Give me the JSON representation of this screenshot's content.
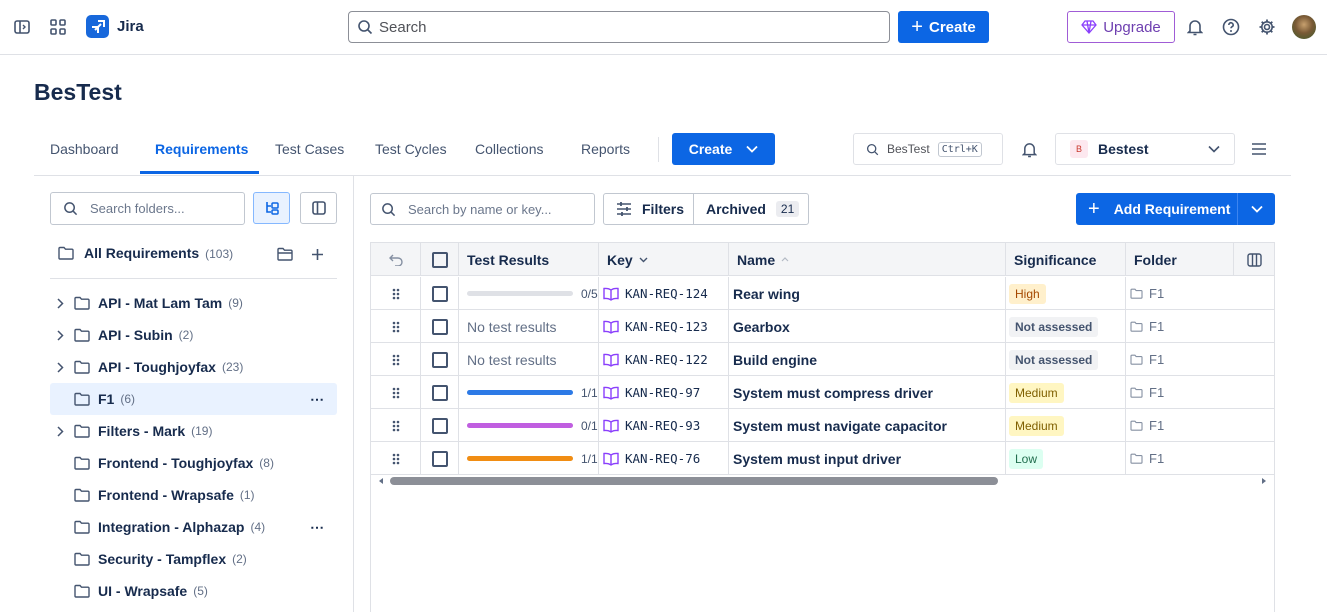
{
  "topbar": {
    "app_name": "Jira",
    "search_placeholder": "Search",
    "create_label": "Create",
    "upgrade_label": "Upgrade"
  },
  "project": {
    "title": "BesTest",
    "tabs": [
      {
        "label": "Dashboard",
        "active": false
      },
      {
        "label": "Requirements",
        "active": true
      },
      {
        "label": "Test Cases",
        "active": false
      },
      {
        "label": "Test Cycles",
        "active": false
      },
      {
        "label": "Collections",
        "active": false
      },
      {
        "label": "Reports",
        "active": false
      }
    ],
    "create_label": "Create",
    "search_label": "BesTest",
    "shortcut": "Ctrl+K",
    "selector_badge": "B",
    "selector_label": "Bestest"
  },
  "sidebar": {
    "search_placeholder": "Search folders...",
    "all_label": "All Requirements",
    "all_count": "(103)",
    "folders": [
      {
        "name": "API - Mat Lam Tam",
        "count": "(9)",
        "expandable": true,
        "selected": false,
        "more": false
      },
      {
        "name": "API - Subin",
        "count": "(2)",
        "expandable": true,
        "selected": false,
        "more": false
      },
      {
        "name": "API - Toughjoyfax",
        "count": "(23)",
        "expandable": true,
        "selected": false,
        "more": false
      },
      {
        "name": "F1",
        "count": "(6)",
        "expandable": false,
        "selected": true,
        "more": true
      },
      {
        "name": "Filters - Mark",
        "count": "(19)",
        "expandable": true,
        "selected": false,
        "more": false
      },
      {
        "name": "Frontend - Toughjoyfax",
        "count": "(8)",
        "expandable": false,
        "selected": false,
        "more": false
      },
      {
        "name": "Frontend - Wrapsafe",
        "count": "(1)",
        "expandable": false,
        "selected": false,
        "more": false
      },
      {
        "name": "Integration - Alphazap",
        "count": "(4)",
        "expandable": false,
        "selected": false,
        "more": true
      },
      {
        "name": "Security - Tampflex",
        "count": "(2)",
        "expandable": false,
        "selected": false,
        "more": false
      },
      {
        "name": "UI - Wrapsafe",
        "count": "(5)",
        "expandable": false,
        "selected": false,
        "more": false
      }
    ]
  },
  "toolbar": {
    "search_placeholder": "Search by name or key...",
    "filters_label": "Filters",
    "archived_label": "Archived",
    "archived_count": "21",
    "add_label": "Add Requirement"
  },
  "table": {
    "columns": {
      "results": "Test Results",
      "key": "Key",
      "name": "Name",
      "significance": "Significance",
      "folder": "Folder"
    },
    "rows": [
      {
        "result_text": "",
        "fraction": "0/5",
        "progress": 0,
        "color": "#dfe1e6",
        "key": "KAN-REQ-124",
        "name": "Rear wing",
        "significance": "High",
        "folder": "F1"
      },
      {
        "result_text": "No test results",
        "fraction": "",
        "progress": null,
        "color": "",
        "key": "KAN-REQ-123",
        "name": "Gearbox",
        "significance": "Not assessed",
        "folder": "F1"
      },
      {
        "result_text": "No test results",
        "fraction": "",
        "progress": null,
        "color": "",
        "key": "KAN-REQ-122",
        "name": "Build engine",
        "significance": "Not assessed",
        "folder": "F1"
      },
      {
        "result_text": "",
        "fraction": "1/1",
        "progress": 1,
        "color": "#2d7ae6",
        "key": "KAN-REQ-97",
        "name": "System must compress driver",
        "significance": "Medium",
        "folder": "F1"
      },
      {
        "result_text": "",
        "fraction": "0/1",
        "progress": 1,
        "color": "#c05ee0",
        "key": "KAN-REQ-93",
        "name": "System must navigate capacitor",
        "significance": "Medium",
        "folder": "F1"
      },
      {
        "result_text": "",
        "fraction": "1/1",
        "progress": 1,
        "color": "#f18d13",
        "key": "KAN-REQ-76",
        "name": "System must input driver",
        "significance": "Low",
        "folder": "F1"
      }
    ]
  },
  "significance_colors": {
    "High": {
      "bg": "#fff0cc",
      "fg": "#a54800"
    },
    "Medium": {
      "bg": "#fff6c2",
      "fg": "#7f5f01"
    },
    "Low": {
      "bg": "#dcfff1",
      "fg": "#216e4e"
    },
    "Not assessed": {
      "bg": "#f1f2f4",
      "fg": "#44546f"
    }
  }
}
